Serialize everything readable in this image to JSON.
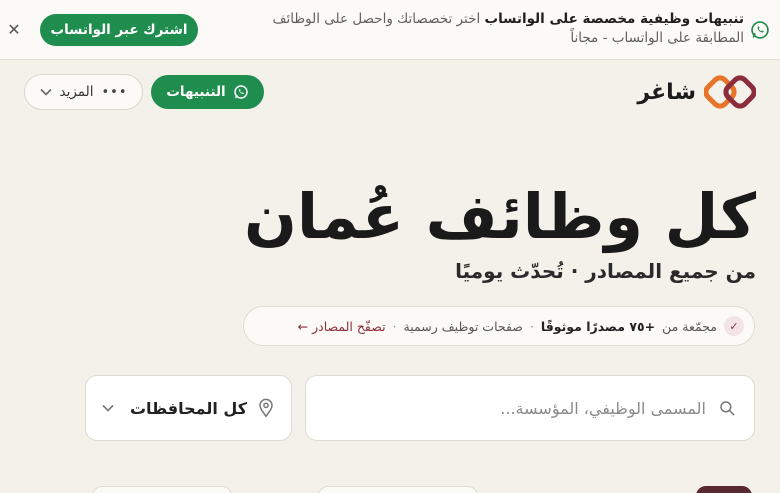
{
  "banner": {
    "headline": "تنبيهات وظيفية مخصصة على الواتساب",
    "body": "اختر تخصصاتك واحصل على الوظائف المطابقة على الواتساب - مجاناً",
    "cta_label": "اشترك عبر الواتساب",
    "close_glyph": "✕"
  },
  "header": {
    "brand": "شاغر",
    "alerts_label": "التنبيهات",
    "more_label": "المزيد",
    "more_dots": "•••",
    "chevron": "⌄"
  },
  "hero": {
    "title": "كل وظائف عُمان",
    "subtitle": "من جميع المصادر · تُحدّث يوميًا"
  },
  "sources": {
    "check_glyph": "✓",
    "prefix": "مجمّعة من",
    "count": "+٧٥ مصدرًا موثوقًا",
    "sep": "·",
    "middle": "صفحات توظيف رسمية",
    "link": "تصفّح المصادر ←"
  },
  "search": {
    "placeholder": "المسمى الوظيفي، المؤسسة..."
  },
  "location": {
    "label": "كل المحافظات"
  },
  "colors": {
    "background": "#f4f1ea",
    "brand_green": "#1f8d4e",
    "accent_maroon": "#8a2d3a",
    "logo_orange": "#e8742a"
  }
}
